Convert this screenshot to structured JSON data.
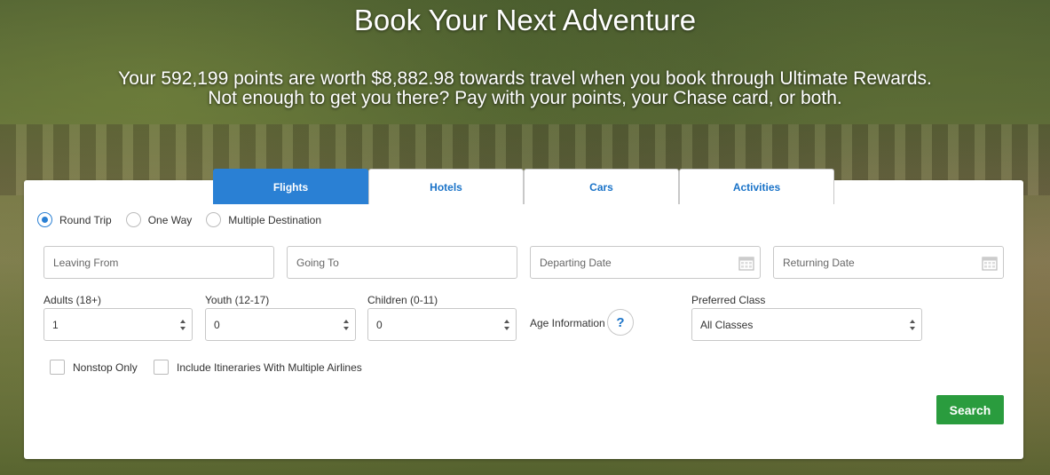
{
  "hero": {
    "title": "Book Your Next Adventure",
    "subtitle_line1": "Your 592,199 points are worth $8,882.98 towards travel when you book through Ultimate Rewards.",
    "subtitle_line2": "Not enough to get you there? Pay with your points, your Chase card, or both."
  },
  "tabs": [
    {
      "label": "Flights",
      "active": true
    },
    {
      "label": "Hotels",
      "active": false
    },
    {
      "label": "Cars",
      "active": false
    },
    {
      "label": "Activities",
      "active": false
    }
  ],
  "trip_types": [
    {
      "label": "Round Trip",
      "checked": true
    },
    {
      "label": "One Way",
      "checked": false
    },
    {
      "label": "Multiple Destination",
      "checked": false
    }
  ],
  "fields": {
    "leaving_from": {
      "placeholder": "Leaving From",
      "value": ""
    },
    "going_to": {
      "placeholder": "Going To",
      "value": ""
    },
    "departing_date": {
      "placeholder": "Departing Date",
      "value": "",
      "icon": "calendar-icon"
    },
    "returning_date": {
      "placeholder": "Returning Date",
      "value": "",
      "icon": "calendar-icon"
    }
  },
  "passengers": {
    "adults": {
      "label": "Adults (18+)",
      "value": "1"
    },
    "youth": {
      "label": "Youth (12-17)",
      "value": "0"
    },
    "children": {
      "label": "Children (0-11)",
      "value": "0"
    },
    "age_info": {
      "label": "Age Information",
      "icon": "?"
    }
  },
  "preferred_class": {
    "label": "Preferred Class",
    "value": "All Classes"
  },
  "options": {
    "nonstop": {
      "label": "Nonstop Only",
      "checked": false
    },
    "multiple_airlines": {
      "label": "Include Itineraries With Multiple Airlines",
      "checked": false
    }
  },
  "search_button": {
    "label": "Search",
    "color": "#2a9c3e"
  },
  "colors": {
    "accent": "#2a80d4",
    "tab_text": "#1a73c8"
  }
}
